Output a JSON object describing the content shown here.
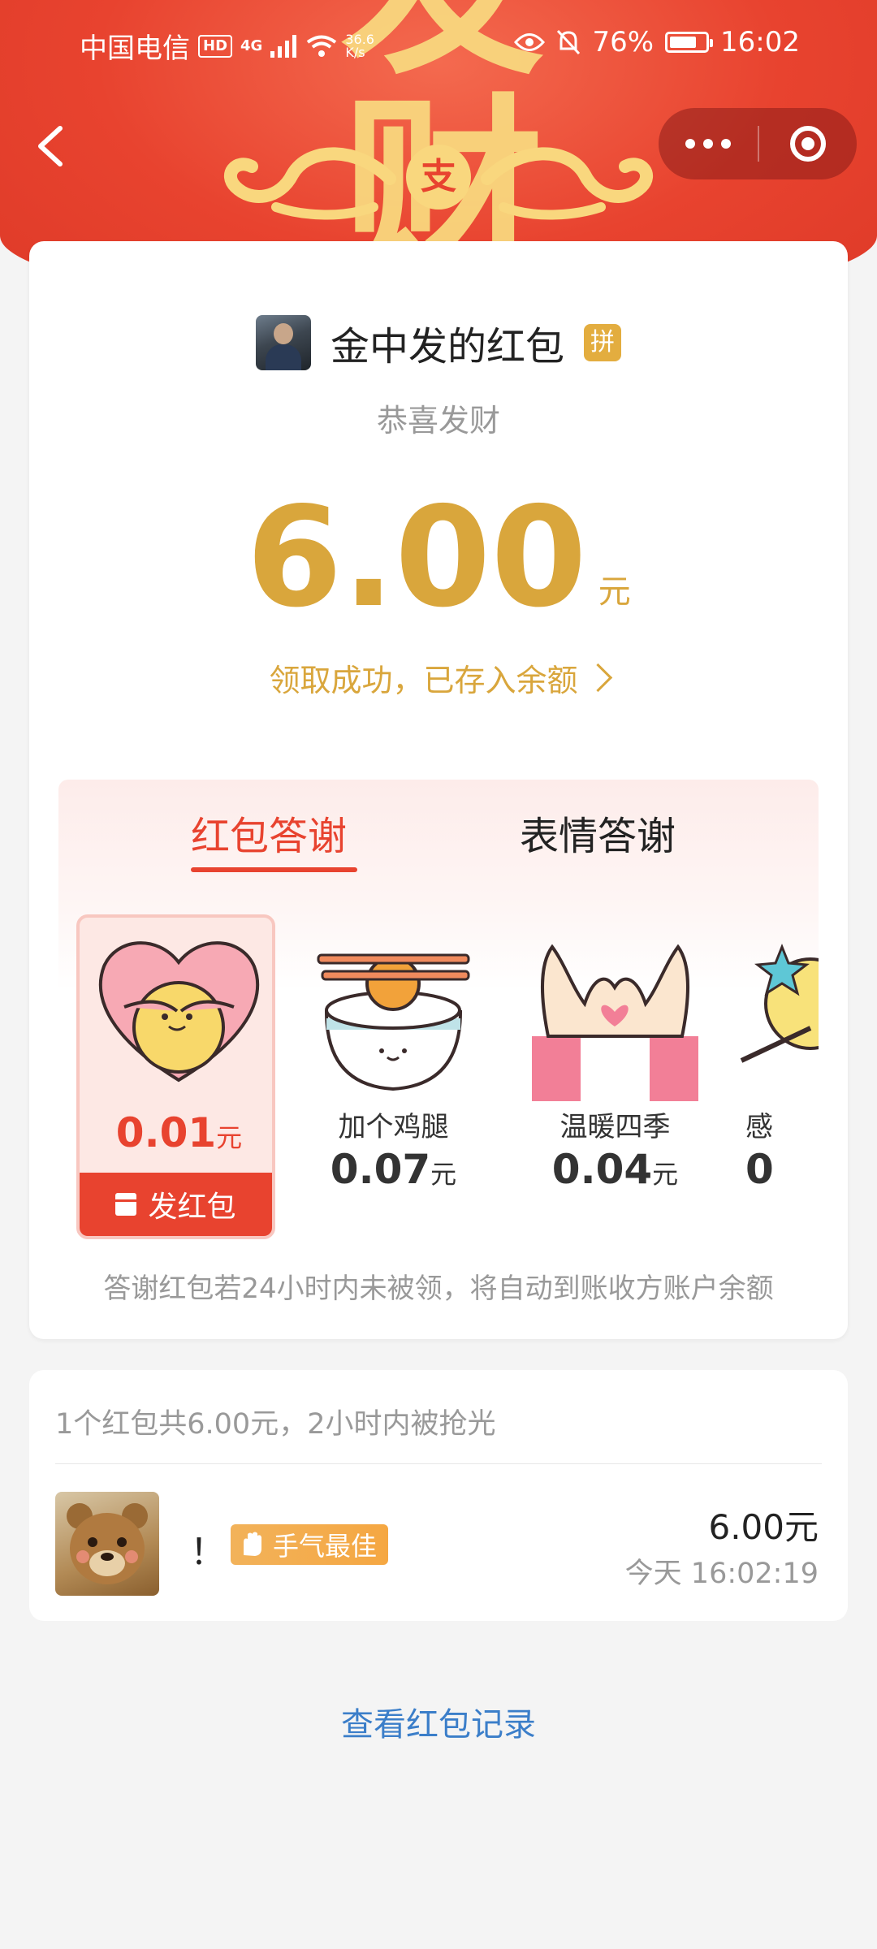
{
  "status_bar": {
    "carrier": "中国电信",
    "hd": "HD",
    "network": "4G",
    "speed_value": "36.6",
    "speed_unit": "K/s",
    "battery": "76%",
    "battery_level": 0.76,
    "time": "16:02"
  },
  "banner": {
    "coin_char": "支"
  },
  "nav": {
    "back_icon": "chevron-left-icon",
    "more_icon": "more-dots-icon",
    "close_icon": "target-close-icon"
  },
  "packet": {
    "sender_name": "金中发的红包",
    "badge": "拼",
    "greeting": "恭喜发财",
    "amount": "6.00",
    "unit": "元",
    "received_text": "领取成功，已存入余额"
  },
  "thanks": {
    "tabs": [
      {
        "label": "红包答谢",
        "active": true
      },
      {
        "label": "表情答谢",
        "active": false
      }
    ],
    "items": [
      {
        "name": "",
        "amount": "0.01",
        "unit": "元",
        "selected": true,
        "button": "发红包",
        "icon": "heart-hug-icon"
      },
      {
        "name": "加个鸡腿",
        "amount": "0.07",
        "unit": "元",
        "selected": false,
        "icon": "rice-bowl-drumstick-icon"
      },
      {
        "name": "温暖四季",
        "amount": "0.04",
        "unit": "元",
        "selected": false,
        "icon": "finger-heart-icon"
      },
      {
        "name": "感",
        "amount": "0",
        "unit": "",
        "selected": false,
        "icon": "star-wand-icon"
      }
    ],
    "note": "答谢红包若24小时内未被领，将自动到账收方账户余额"
  },
  "summary": {
    "text": "1个红包共6.00元，2小时内被抢光",
    "winner": {
      "name": "！",
      "badge": "手气最佳",
      "amount": "6.00元",
      "time": "今天 16:02:19"
    }
  },
  "records_link": "查看红包记录",
  "colors": {
    "banner_red": "#e8432f",
    "gold": "#d9a63c",
    "link_blue": "#3b7ec9",
    "page_bg": "#f4f4f4"
  }
}
